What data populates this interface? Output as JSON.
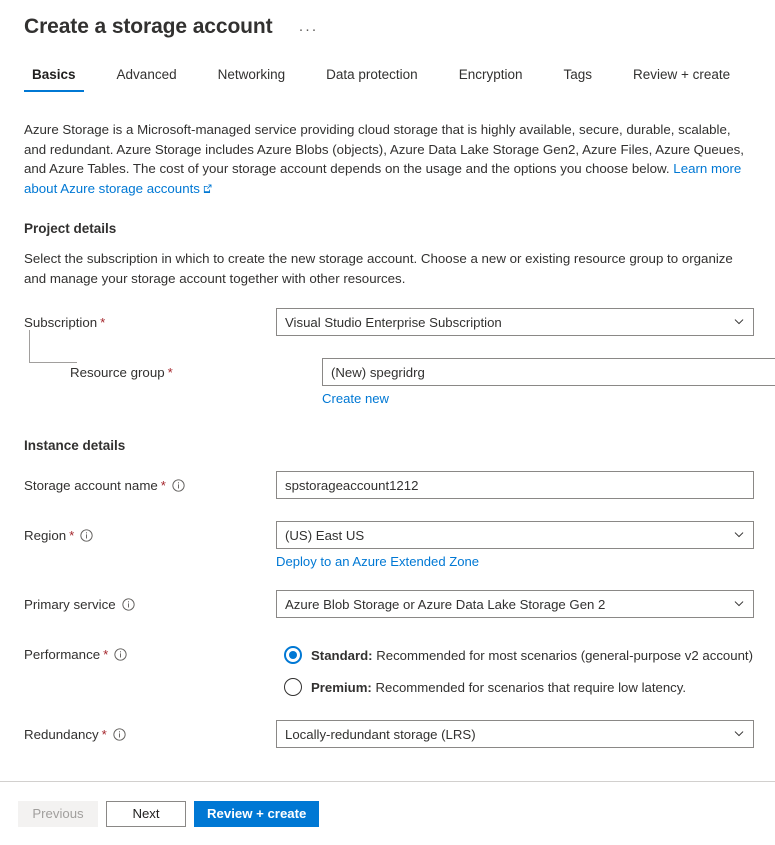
{
  "blade": {
    "title": "Create a storage account",
    "more_menu": "···"
  },
  "tabs": [
    {
      "label": "Basics",
      "active": true
    },
    {
      "label": "Advanced",
      "active": false
    },
    {
      "label": "Networking",
      "active": false
    },
    {
      "label": "Data protection",
      "active": false
    },
    {
      "label": "Encryption",
      "active": false
    },
    {
      "label": "Tags",
      "active": false
    },
    {
      "label": "Review + create",
      "active": false
    }
  ],
  "intro": {
    "text": "Azure Storage is a Microsoft-managed service providing cloud storage that is highly available, secure, durable, scalable, and redundant. Azure Storage includes Azure Blobs (objects), Azure Data Lake Storage Gen2, Azure Files, Azure Queues, and Azure Tables. The cost of your storage account depends on the usage and the options you choose below. ",
    "link_text": "Learn more about Azure storage accounts"
  },
  "project_details": {
    "title": "Project details",
    "description": "Select the subscription in which to create the new storage account. Choose a new or existing resource group to organize and manage your storage account together with other resources.",
    "subscription": {
      "label": "Subscription",
      "required": "*",
      "value": "Visual Studio Enterprise Subscription"
    },
    "resource_group": {
      "label": "Resource group",
      "required": "*",
      "value": "(New) spegridrg",
      "create_new_link": "Create new"
    }
  },
  "instance_details": {
    "title": "Instance details",
    "storage_account_name": {
      "label": "Storage account name",
      "required": "*",
      "value": "spstorageaccount1212"
    },
    "region": {
      "label": "Region",
      "required": "*",
      "value": "(US) East US",
      "extended_zone_link": "Deploy to an Azure Extended Zone"
    },
    "primary_service": {
      "label": "Primary service",
      "value": "Azure Blob Storage or Azure Data Lake Storage Gen 2"
    },
    "performance": {
      "label": "Performance",
      "required": "*",
      "options": [
        {
          "name": "Standard:",
          "description": " Recommended for most scenarios (general-purpose v2 account)",
          "selected": true
        },
        {
          "name": "Premium:",
          "description": " Recommended for scenarios that require low latency.",
          "selected": false
        }
      ]
    },
    "redundancy": {
      "label": "Redundancy",
      "required": "*",
      "value": "Locally-redundant storage (LRS)"
    }
  },
  "footer": {
    "previous": "Previous",
    "next": "Next",
    "review_create": "Review + create"
  },
  "colors": {
    "accent": "#0078d4",
    "link": "#0078d4",
    "required_asterisk": "#a4262c",
    "border": "#8a8886",
    "text": "#323130"
  }
}
